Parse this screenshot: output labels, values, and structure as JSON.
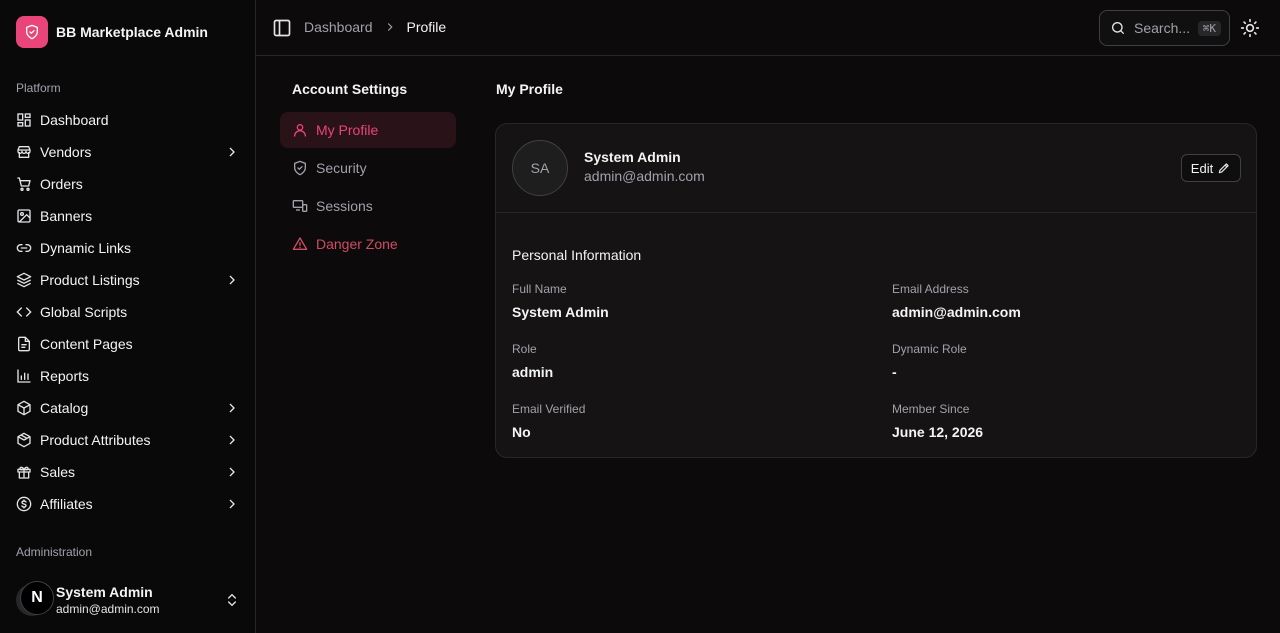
{
  "brand": {
    "title": "BB Marketplace Admin",
    "accent": "#e9457a"
  },
  "sidebar": {
    "section_platform": "Platform",
    "section_admin": "Administration",
    "items": [
      {
        "label": "Dashboard",
        "icon": "dashboard-icon",
        "chevron": false
      },
      {
        "label": "Vendors",
        "icon": "store-icon",
        "chevron": true
      },
      {
        "label": "Orders",
        "icon": "cart-icon",
        "chevron": false
      },
      {
        "label": "Banners",
        "icon": "image-icon",
        "chevron": false
      },
      {
        "label": "Dynamic Links",
        "icon": "link-icon",
        "chevron": false
      },
      {
        "label": "Product Listings",
        "icon": "layers-icon",
        "chevron": true
      },
      {
        "label": "Global Scripts",
        "icon": "code-icon",
        "chevron": false
      },
      {
        "label": "Content Pages",
        "icon": "file-icon",
        "chevron": false
      },
      {
        "label": "Reports",
        "icon": "bar-chart-icon",
        "chevron": false
      },
      {
        "label": "Catalog",
        "icon": "package-icon",
        "chevron": true
      },
      {
        "label": "Product Attributes",
        "icon": "box-icon",
        "chevron": true
      },
      {
        "label": "Sales",
        "icon": "gift-icon",
        "chevron": true
      },
      {
        "label": "Affiliates",
        "icon": "dollar-circle-icon",
        "chevron": true
      }
    ],
    "user": {
      "badge": "N",
      "name": "System Admin",
      "email": "admin@admin.com"
    }
  },
  "topbar": {
    "breadcrumb": {
      "parent": "Dashboard",
      "current": "Profile"
    },
    "search": {
      "placeholder": "Search...",
      "shortcut": "⌘K"
    }
  },
  "settings": {
    "title": "Account Settings",
    "items": [
      {
        "label": "My Profile",
        "icon": "user-icon",
        "active": true,
        "color": "#e9457a"
      },
      {
        "label": "Security",
        "icon": "shield-icon",
        "active": false,
        "color": "#a1a1aa"
      },
      {
        "label": "Sessions",
        "icon": "devices-icon",
        "active": false,
        "color": "#a1a1aa"
      },
      {
        "label": "Danger Zone",
        "icon": "warning-icon",
        "active": false,
        "color": "#d14b62"
      }
    ]
  },
  "profile": {
    "title": "My Profile",
    "initials": "SA",
    "name": "System Admin",
    "email": "admin@admin.com",
    "edit_label": "Edit",
    "section_title": "Personal Information",
    "fields": [
      {
        "label": "Full Name",
        "value": "System Admin"
      },
      {
        "label": "Email Address",
        "value": "admin@admin.com"
      },
      {
        "label": "Role",
        "value": "admin"
      },
      {
        "label": "Dynamic Role",
        "value": "-"
      },
      {
        "label": "Email Verified",
        "value": "No"
      },
      {
        "label": "Member Since",
        "value": "June 12, 2026"
      }
    ]
  }
}
